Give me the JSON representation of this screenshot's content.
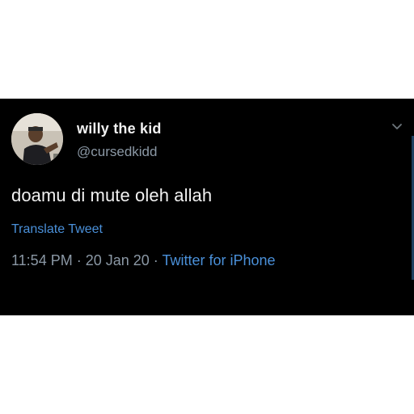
{
  "tweet": {
    "display_name": "willy the kid",
    "handle": "@cursedkidd",
    "text": "doamu di mute oleh allah",
    "translate_label": "Translate Tweet",
    "time": "11:54 PM",
    "separator1": " · ",
    "date": "20 Jan 20",
    "separator2": " · ",
    "source": "Twitter for iPhone"
  },
  "icons": {
    "menu": "chevron-down-icon",
    "avatar": "avatar"
  },
  "colors": {
    "background": "#000000",
    "text": "#f2f2f2",
    "secondary": "#8b98a5",
    "link": "#4a90d9"
  }
}
